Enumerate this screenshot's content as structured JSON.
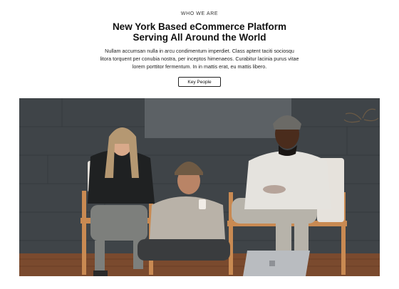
{
  "section": {
    "eyebrow": "WHO WE ARE",
    "title_line1": "New York Based eCommerce Platform",
    "title_line2": "Serving All Around the World",
    "body_line1": "Nullam accumsan nulla in arcu condimentum imperdiet. Class aptent taciti sociosqu",
    "body_line2": "litora torquent per conubia nostra, per inceptos himenaeos. Curabitur lacinia purus vitae",
    "body_line3": "lorem porttitor fermentum. In in mattis erat, eu mattis libero.",
    "button_label": "Key People"
  },
  "photo": {
    "icon": "team-photo",
    "colors": {
      "wall": "#3f4448",
      "panel": "#5a5f63",
      "floor": "#7a4a2e",
      "chair_wood": "#c98a52",
      "laptop": "#b9bcc0"
    }
  }
}
